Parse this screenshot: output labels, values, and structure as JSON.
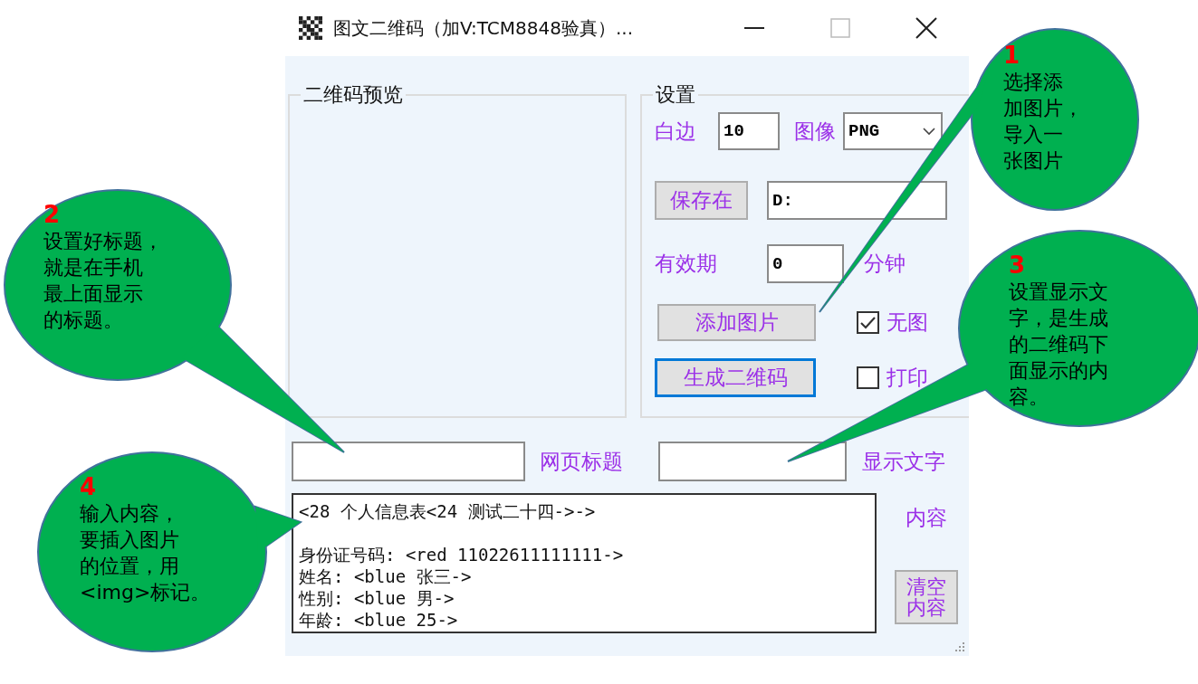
{
  "window": {
    "title": "图文二维码（加V:TCM8848验真）..."
  },
  "preview_group": {
    "label": "二维码预览"
  },
  "settings_group": {
    "label": "设置",
    "margin": {
      "label": "白边",
      "value": "10"
    },
    "image_format": {
      "label": "图像",
      "value": "PNG"
    },
    "save_button": {
      "label": "保存在"
    },
    "save_path": {
      "value": "D:"
    },
    "expiry": {
      "label": "有效期",
      "value": "0",
      "unit": "分钟"
    },
    "add_image_button": {
      "label": "添加图片"
    },
    "no_image": {
      "label": "无图",
      "checked": true
    },
    "generate_button": {
      "label": "生成二维码",
      "focused": true
    },
    "print": {
      "label": "打印",
      "checked": false
    }
  },
  "page_title": {
    "label": "网页标题"
  },
  "display_text": {
    "label": "显示文字"
  },
  "content": {
    "label": "内容",
    "text": "<28 个人信息表<24 测试二十四->->\n\n身份证号码: <red 11022611111111->\n姓名: <blue 张三->\n性别: <blue 男->\n年龄: <blue 25->"
  },
  "clear_button": {
    "label": "清空内容"
  },
  "callouts": [
    {
      "number": "1",
      "lines": [
        "选择添",
        "加图片，",
        "导入一",
        "张图片"
      ]
    },
    {
      "number": "2",
      "lines": [
        "设置好标题，",
        "就是在手机",
        "最上面显示",
        "的标题。"
      ]
    },
    {
      "number": "3",
      "lines": [
        "设置显示文",
        "字，是生成",
        "的二维码下",
        "面显示的内",
        "容。"
      ]
    },
    {
      "number": "4",
      "lines": [
        "输入内容，",
        "要插入图片",
        "的位置，用",
        "<img>标记。"
      ]
    }
  ]
}
